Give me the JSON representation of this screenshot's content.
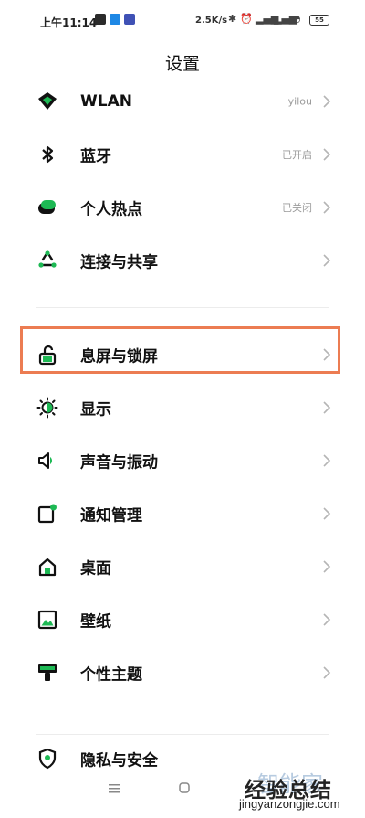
{
  "status_bar": {
    "time": "上午11:14",
    "net_speed": "2.5K/s",
    "battery_level": "55"
  },
  "page_title": "设置",
  "settings": [
    {
      "id": "wlan",
      "label": "WLAN",
      "value": "yilou",
      "icon": "wifi-icon"
    },
    {
      "id": "bluetooth",
      "label": "蓝牙",
      "value": "已开启",
      "icon": "bluetooth-icon"
    },
    {
      "id": "hotspot",
      "label": "个人热点",
      "value": "已关闭",
      "icon": "hotspot-icon"
    },
    {
      "id": "connection",
      "label": "连接与共享",
      "value": "",
      "icon": "share-icon"
    },
    {
      "id": "lockscreen",
      "label": "息屏与锁屏",
      "value": "",
      "icon": "lock-icon"
    },
    {
      "id": "display",
      "label": "显示",
      "value": "",
      "icon": "brightness-icon"
    },
    {
      "id": "sound",
      "label": "声音与振动",
      "value": "",
      "icon": "speaker-icon"
    },
    {
      "id": "notifications",
      "label": "通知管理",
      "value": "",
      "icon": "notification-icon"
    },
    {
      "id": "desktop",
      "label": "桌面",
      "value": "",
      "icon": "home-icon"
    },
    {
      "id": "wallpaper",
      "label": "壁纸",
      "value": "",
      "icon": "wallpaper-icon"
    },
    {
      "id": "themes",
      "label": "个性主题",
      "value": "",
      "icon": "theme-icon"
    },
    {
      "id": "privacy",
      "label": "隐私与安全",
      "value": "",
      "icon": "shield-icon"
    }
  ],
  "watermark": {
    "faint": "智能家",
    "title": "经验总结",
    "url": "jingyanzongjie.com"
  },
  "colors": {
    "accent": "#1db954",
    "highlight": "#ec7c52"
  }
}
